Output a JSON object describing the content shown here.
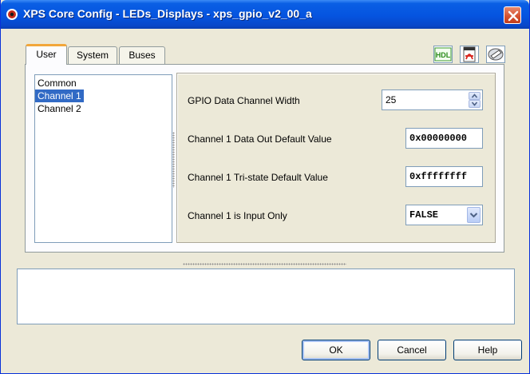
{
  "window": {
    "title": "XPS Core Config - LEDs_Displays - xps_gpio_v2_00_a"
  },
  "tabs": [
    {
      "label": "User",
      "active": true
    },
    {
      "label": "System",
      "active": false
    },
    {
      "label": "Buses",
      "active": false
    }
  ],
  "toolbar": {
    "hdl_label": "HDL",
    "pdf_icon": "pdf-icon",
    "datasheet_icon": "datasheet-icon"
  },
  "channel_list": {
    "items": [
      "Common",
      "Channel 1",
      "Channel 2"
    ],
    "selected": "Channel 1"
  },
  "params": {
    "data_width": {
      "label": "GPIO Data Channel Width",
      "value": "25"
    },
    "dout_default": {
      "label": "Channel 1 Data Out Default Value",
      "value": "0x00000000"
    },
    "tri_default": {
      "label": "Channel 1 Tri-state Default Value",
      "value": "0xffffffff"
    },
    "input_only": {
      "label": "Channel 1 is Input Only",
      "value": "FALSE"
    }
  },
  "buttons": {
    "ok": "OK",
    "cancel": "Cancel",
    "help": "Help"
  },
  "colors": {
    "title_bar": "#0554e0",
    "selection": "#316ac5",
    "active_tab_accent": "#f2a73b",
    "close_button": "#d4502e"
  }
}
